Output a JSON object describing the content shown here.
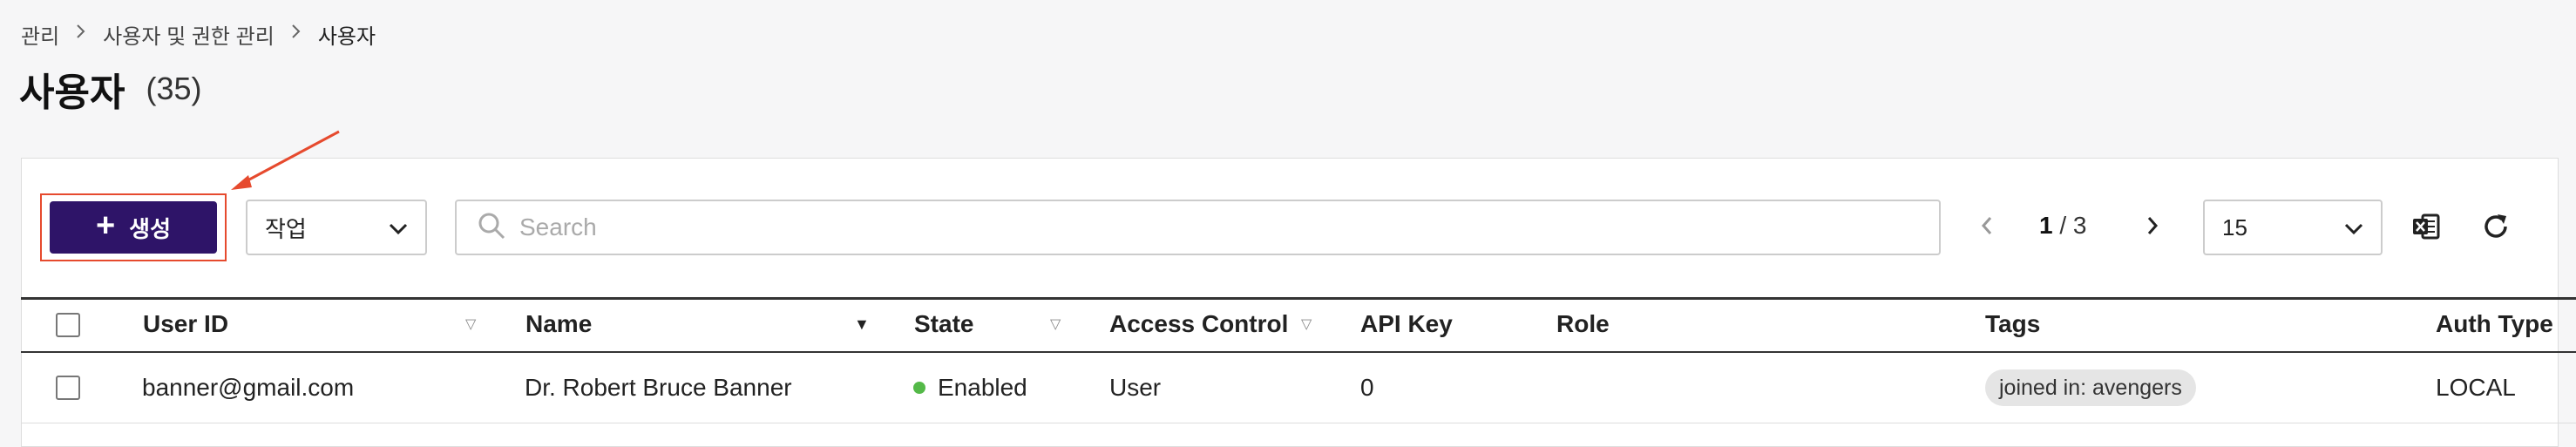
{
  "breadcrumb": {
    "items": [
      "관리",
      "사용자 및 권한 관리",
      "사용자"
    ],
    "separator_icon": "chevron-right-icon"
  },
  "page": {
    "title": "사용자",
    "count": "(35)"
  },
  "toolbar": {
    "create_label": "생성",
    "create_icon": "plus-icon",
    "action_select_value": "작업",
    "search_placeholder": "Search",
    "search_value": "",
    "pagination": {
      "current": "1",
      "separator": " / ",
      "total": "3"
    },
    "page_size_value": "15",
    "accent_color": "#2e1468",
    "annotation_color": "#e64a2e"
  },
  "table": {
    "headers": {
      "user_id": "User ID",
      "name": "Name",
      "state": "State",
      "access_control": "Access Control",
      "api_key": "API Key",
      "role": "Role",
      "tags": "Tags",
      "auth_type": "Auth Type"
    },
    "sorted_column": "name",
    "rows": [
      {
        "user_id": "banner@gmail.com",
        "name": "Dr. Robert Bruce Banner",
        "state": "Enabled",
        "state_color": "#54b948",
        "access_control": "User",
        "api_key": "0",
        "role": "",
        "tags": "joined in: avengers",
        "auth_type": "LOCAL"
      }
    ]
  }
}
